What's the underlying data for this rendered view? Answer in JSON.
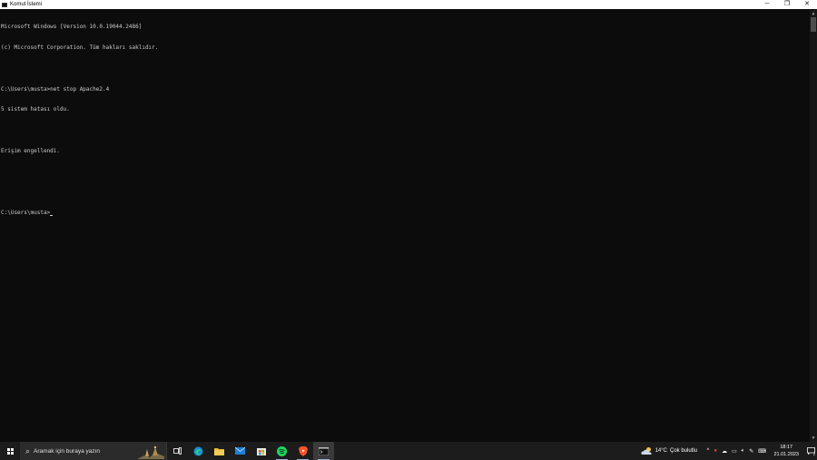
{
  "window": {
    "title": "Komut İstemi"
  },
  "console": {
    "lines": [
      "Microsoft Windows [Version 10.0.19044.2486]",
      "(c) Microsoft Corporation. Tüm hakları saklıdır.",
      "",
      "C:\\Users\\musta>net stop Apache2.4",
      "5 sistem hatası oldu.",
      "",
      "Erişim engellendi.",
      "",
      "",
      "C:\\Users\\musta>"
    ]
  },
  "taskbar": {
    "search_placeholder": "Aramak için buraya yazın",
    "pinned_apps": [
      "task-view",
      "edge",
      "file-explorer",
      "mail",
      "store",
      "spotify",
      "brave",
      "command-prompt"
    ]
  },
  "tray": {
    "temperature": "14°C",
    "weather": "Çok bulutlu",
    "time": "18:17",
    "date": "21.01.2023",
    "notification_count": "2"
  },
  "colors": {
    "console_bg": "#0c0c0c",
    "console_fg": "#cccccc",
    "taskbar_bg": "#1c1c1c"
  }
}
